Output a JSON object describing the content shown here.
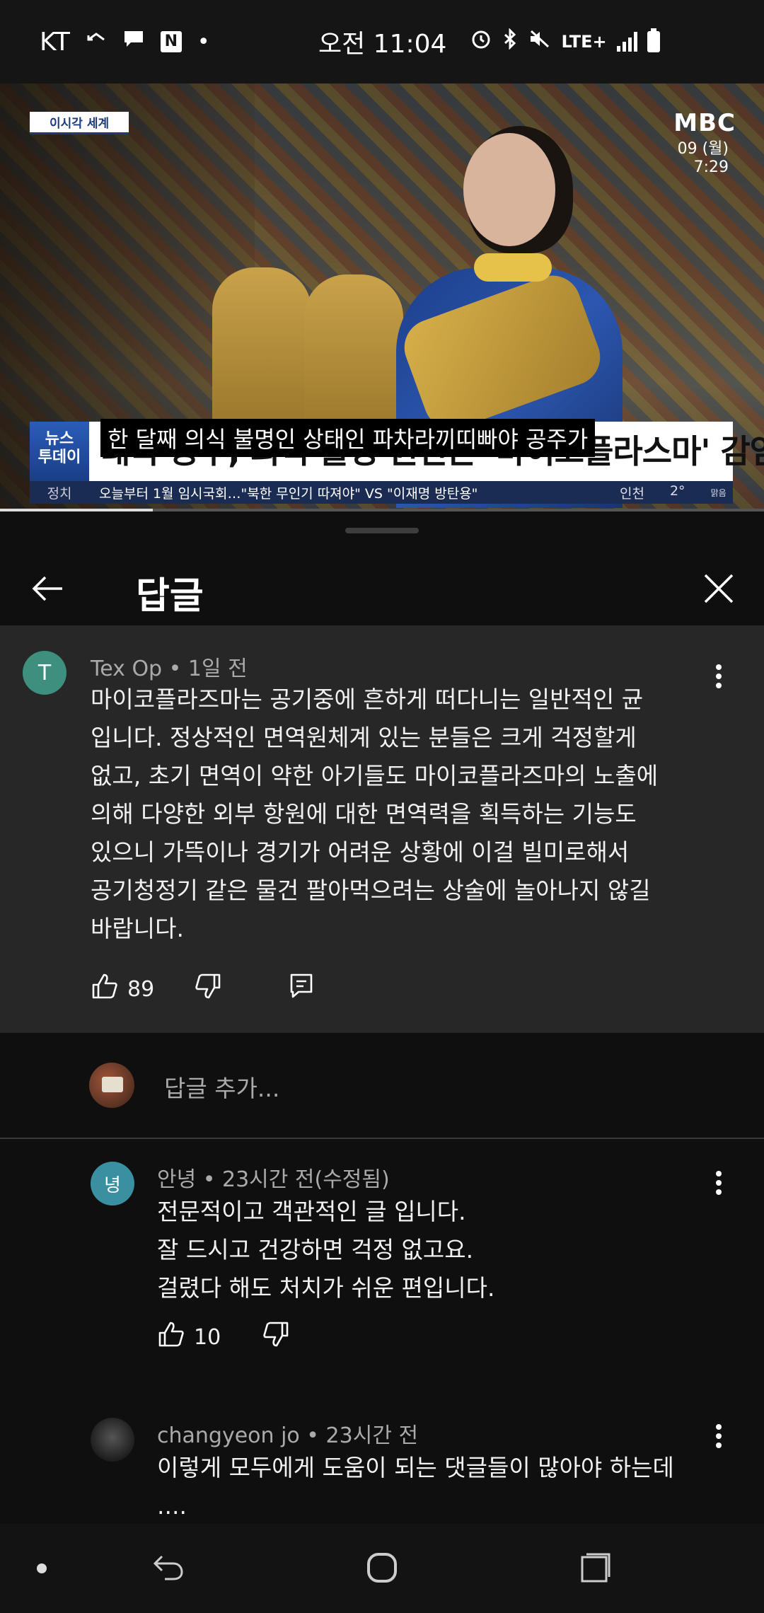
{
  "status_bar": {
    "carrier": "KT",
    "time": "오전 11:04",
    "network": "LTE+",
    "notif_icons": [
      "missed-call-icon",
      "chat-icon",
      "naver-icon",
      "dot-icon"
    ],
    "sys_icons": [
      "alarm-icon",
      "bluetooth-icon",
      "mute-icon",
      "lte-icon",
      "signal-icon",
      "battery-icon"
    ]
  },
  "video": {
    "segment_tag": "이시각 세계",
    "channel_logo": "MBC",
    "date_line1": "09 (월)",
    "date_line2": "7:29",
    "program_logo_line1": "뉴스",
    "program_logo_line2": "투데이",
    "headline": "태국 공주, 의식 불명 원인은 '마이코플라스마' 감염",
    "caption": "한 달째 의식 불명인 상태인 파차라끼띠빠야 공주가",
    "ticker_category": "정치",
    "ticker_text": "오늘부터 1월 임시국회…\"북한 무인기 따져야\" VS \"이재명 방탄용\"",
    "weather_city": "인천",
    "weather_temp": "2°",
    "weather_sky": "맑음",
    "progress_fraction": 0.2
  },
  "panel": {
    "title": "답글",
    "back_icon": "arrow-left-icon",
    "close_icon": "close-icon"
  },
  "parent_comment": {
    "avatar_letter": "T",
    "avatar_color": "#3e8f7e",
    "author": "Tex Op",
    "time": "1일 전",
    "text": "마이코플라즈마는 공기중에 흔하게 떠다니는 일반적인 균\n입니다. 정상적인 면역원체계 있는 분들은 크게 걱정할게\n없고, 초기 면역이 약한 아기들도 마이코플라즈마의 노출에\n의해 다양한 외부 항원에 대한 면역력을 획득하는 기능도\n있으니 가뜩이나 경기가 어려운 상황에 이걸 빌미로해서\n공기청정기 같은 물건 팔아먹으려는 상술에 놀아나지 않길\n바랍니다.",
    "likes": "89"
  },
  "reply_input": {
    "placeholder": "답글 추가..."
  },
  "replies": [
    {
      "avatar_letter": "녕",
      "avatar_color": "#3a8fa0",
      "author": "안녕",
      "time": "23시간 전(수정됨)",
      "text": "전문적이고 객관적인 글 입니다.\n잘 드시고 건강하면 걱정 없고요.\n걸렸다 해도  처치가 쉬운 편입니다.",
      "likes": "10"
    },
    {
      "avatar_letter": "",
      "avatar_color": "#2b2b2b",
      "author": "changyeon jo",
      "time": "23시간 전",
      "text": "이렇게 모두에게 도움이 되는 댓글들이 많아야 하는데\n....",
      "likes": ""
    }
  ],
  "sep": " • ",
  "nav": {
    "back_icon": "nav-back-icon",
    "home_icon": "nav-home-icon",
    "recents_icon": "nav-recents-icon"
  }
}
